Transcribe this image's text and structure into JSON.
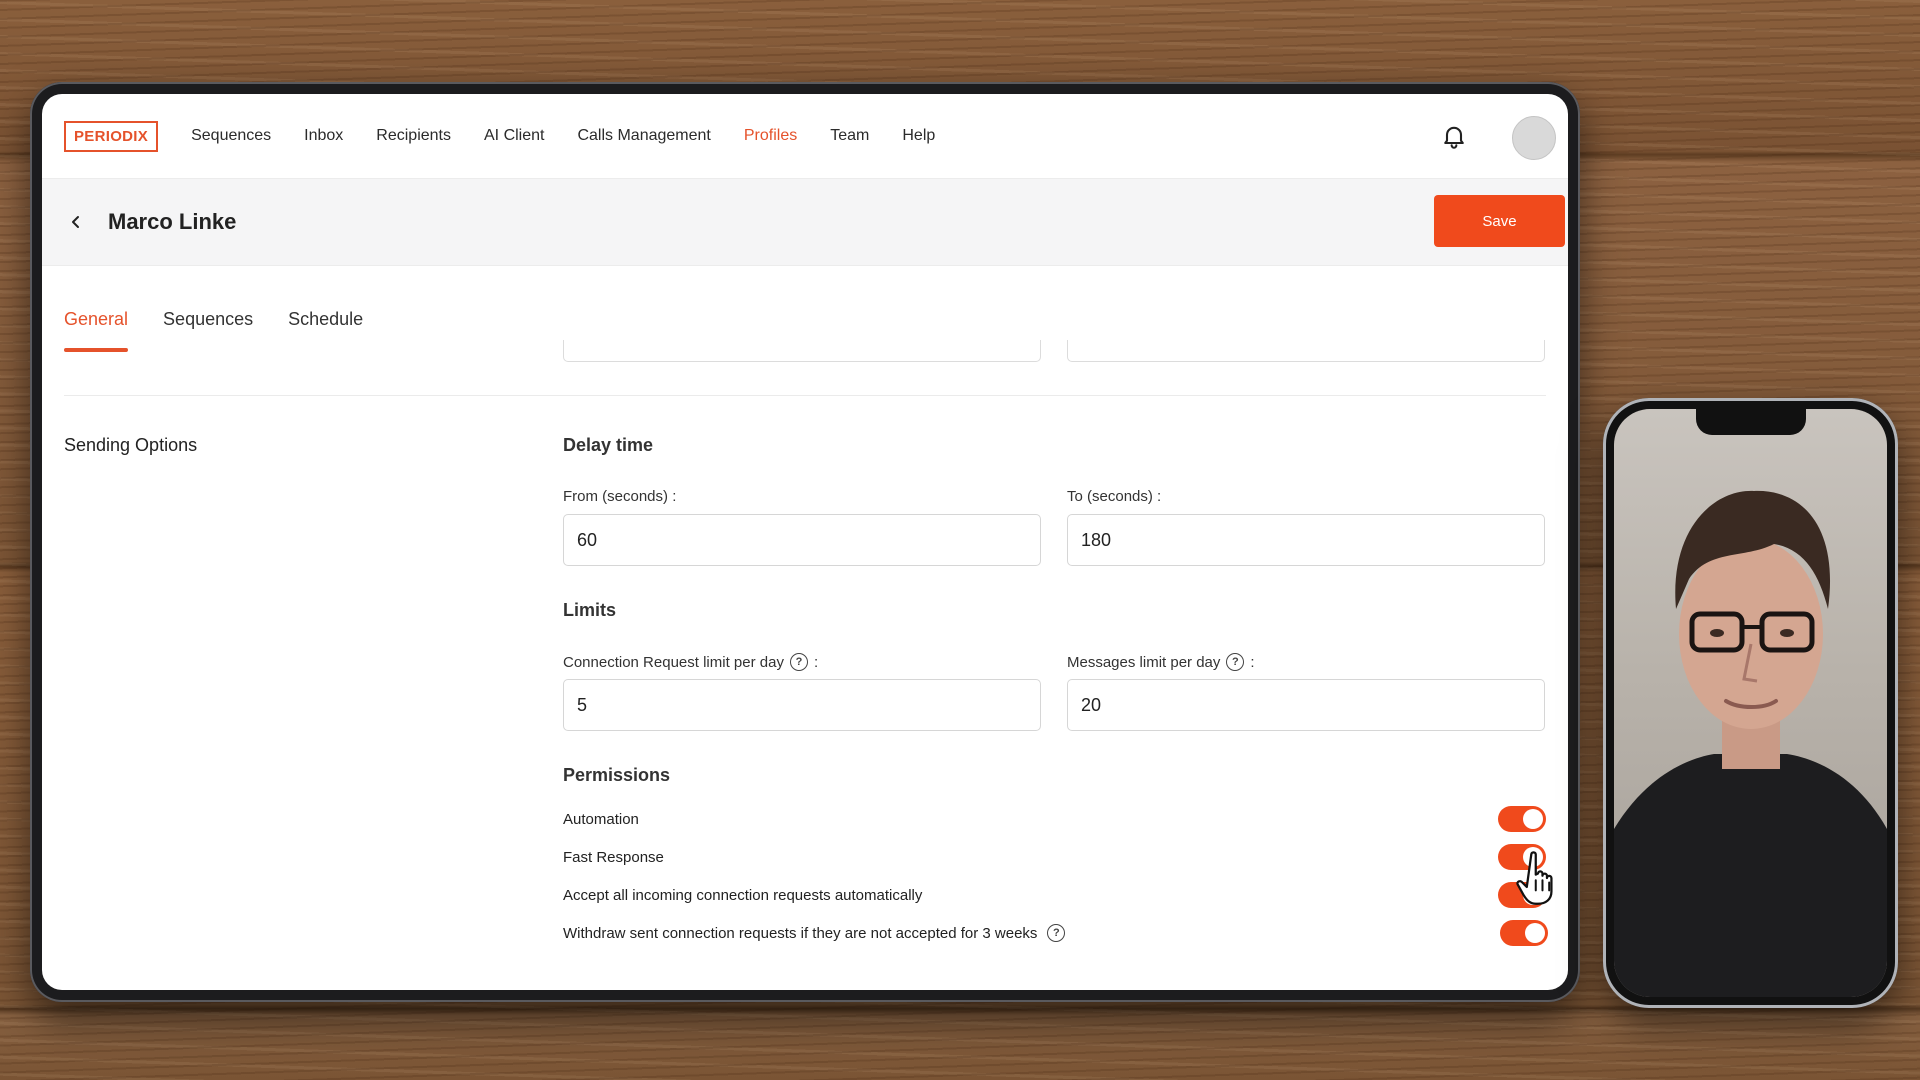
{
  "brand": {
    "logo_text": "PERIODIX",
    "accent": "#f04a1c"
  },
  "nav": {
    "items": [
      {
        "label": "Sequences"
      },
      {
        "label": "Inbox"
      },
      {
        "label": "Recipients"
      },
      {
        "label": "AI Client"
      },
      {
        "label": "Calls Management"
      },
      {
        "label": "Profiles",
        "active": true
      },
      {
        "label": "Team"
      },
      {
        "label": "Help"
      }
    ],
    "bell_icon": "bell-icon",
    "avatar_icon": "avatar"
  },
  "header": {
    "title": "Marco Linke",
    "save_label": "Save",
    "back_icon": "chevron-left-icon"
  },
  "tabs": [
    {
      "label": "General",
      "active": true
    },
    {
      "label": "Sequences"
    },
    {
      "label": "Schedule"
    }
  ],
  "sending_options": {
    "section_label": "Sending Options",
    "delay": {
      "heading": "Delay time",
      "from_label": "From (seconds) :",
      "from_value": "60",
      "to_label": "To (seconds) :",
      "to_value": "180"
    },
    "limits": {
      "heading": "Limits",
      "connection_label": "Connection Request limit per day",
      "connection_value": "5",
      "messages_label": "Messages limit per day",
      "messages_value": "20",
      "colon": ":"
    },
    "permissions": {
      "heading": "Permissions",
      "items": [
        {
          "label": "Automation",
          "enabled": true
        },
        {
          "label": "Fast Response",
          "enabled": true
        },
        {
          "label": "Accept all incoming connection requests automatically",
          "enabled": true
        },
        {
          "label": "Withdraw sent connection requests if they are not accepted for 3 weeks",
          "enabled": true,
          "help": true
        }
      ]
    }
  },
  "help_glyph": "?"
}
